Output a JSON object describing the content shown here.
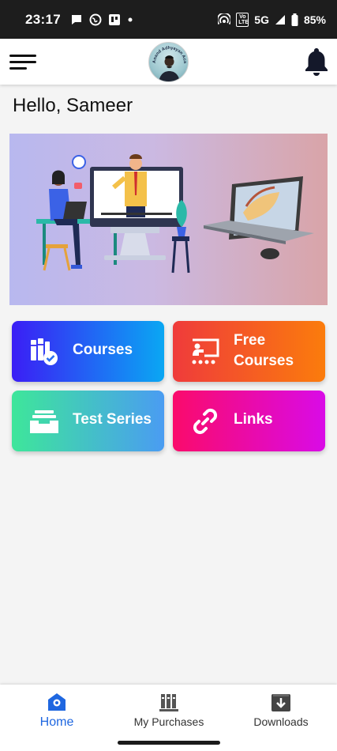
{
  "status_bar": {
    "time": "23:17",
    "network": "5G",
    "battery": "85%",
    "volte": "Vo LTE"
  },
  "app_bar": {
    "logo_text": "Anand Adhyayan Academy"
  },
  "greeting": "Hello, Sameer",
  "cards": [
    {
      "label_line1": "Courses",
      "label_line2": "",
      "icon": "books-check-icon",
      "colors": [
        "#3b1ef5",
        "#0aa7f3"
      ]
    },
    {
      "label_line1": "Free",
      "label_line2": "Courses",
      "icon": "presentation-icon",
      "colors": [
        "#ef3b3b",
        "#fb7c0c"
      ]
    },
    {
      "label_line1": "Test Series",
      "label_line2": "",
      "icon": "tray-icon",
      "colors": [
        "#3ee69a",
        "#4a9cf2"
      ]
    },
    {
      "label_line1": "Links",
      "label_line2": "",
      "icon": "link-icon",
      "colors": [
        "#fa0b6b",
        "#d90be7"
      ]
    }
  ],
  "bottom_nav": [
    {
      "label": "Home",
      "icon": "home-icon",
      "active": true
    },
    {
      "label": "My Purchases",
      "icon": "library-icon",
      "active": false
    },
    {
      "label": "Downloads",
      "icon": "download-icon",
      "active": false
    }
  ],
  "colors": {
    "accent": "#1f67e0",
    "status_bar": "#1d1d1d"
  }
}
